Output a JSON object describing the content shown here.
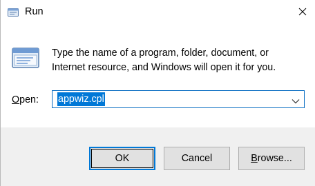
{
  "window": {
    "title": "Run",
    "close_glyph": "✕"
  },
  "content": {
    "description_line1": "Type the name of a program, folder, document, or",
    "description_line2": "Internet resource, and Windows will open it for you.",
    "open_label_underlined": "O",
    "open_label_rest": "pen:",
    "open_value": "appwiz.cpl"
  },
  "buttons": {
    "ok": "OK",
    "cancel": "Cancel",
    "browse_underlined": "B",
    "browse_rest": "rowse..."
  },
  "colors": {
    "accent": "#0078d7",
    "footer_bg": "#f0f0f0",
    "button_bg": "#e1e1e1"
  },
  "icons": {
    "title": "run-icon",
    "content": "run-icon",
    "close": "close-icon",
    "dropdown": "chevron-down-icon"
  }
}
